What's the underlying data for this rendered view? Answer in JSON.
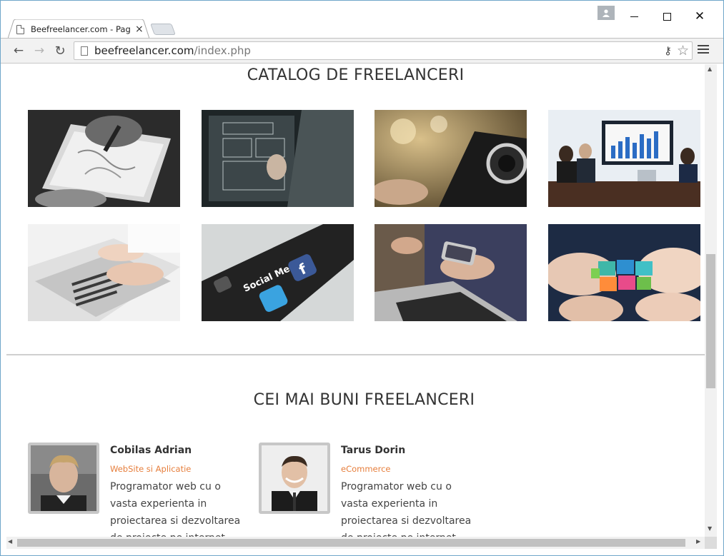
{
  "browser": {
    "tab_title": "Beefreelancer.com - Pagina",
    "tab_close_glyph": "×",
    "url_domain": "beefreelancer.com",
    "url_path": "/index.php",
    "back_glyph": "←",
    "forward_glyph": "→",
    "reload_glyph": "↻",
    "key_glyph": "⚷",
    "star_glyph": "☆",
    "minimize_label": "",
    "close_glyph": "✕"
  },
  "catalog": {
    "title": "CATALOG DE FREELANCERI",
    "tiles": [
      {
        "name": "drawing-tablet-image",
        "desc": "hand drawing on tablet"
      },
      {
        "name": "wireframe-sketch-image",
        "desc": "man sketching wireframe"
      },
      {
        "name": "camera-photographer-image",
        "desc": "camera lens"
      },
      {
        "name": "business-meeting-image",
        "desc": "meeting with chart screen"
      },
      {
        "name": "laptop-typing-image",
        "desc": "hands typing on laptop"
      },
      {
        "name": "social-media-image",
        "desc": "social media app icons"
      },
      {
        "name": "smartphone-laptop-image",
        "desc": "phone over laptop"
      },
      {
        "name": "puzzle-hands-image",
        "desc": "colored puzzle pieces"
      }
    ]
  },
  "best": {
    "title": "CEI MAI BUNI FREELANCERI",
    "freelancers": [
      {
        "name": "Cobilas Adrian",
        "category": "WebSite si Aplicatie",
        "description": "Programator web cu o vasta experienta in proiectarea si dezvoltarea de proiecte pe internet"
      },
      {
        "name": "Tarus Dorin",
        "category": "eCommerce",
        "description": "Programator web cu o vasta experienta in proiectarea si dezvoltarea de proiecte pe internet"
      }
    ]
  },
  "scrollbars": {
    "up_glyph": "▲",
    "down_glyph": "▼",
    "left_glyph": "◀",
    "right_glyph": "▶"
  },
  "colors": {
    "accent": "#e67e3c",
    "window_border": "#6fa6c9"
  }
}
